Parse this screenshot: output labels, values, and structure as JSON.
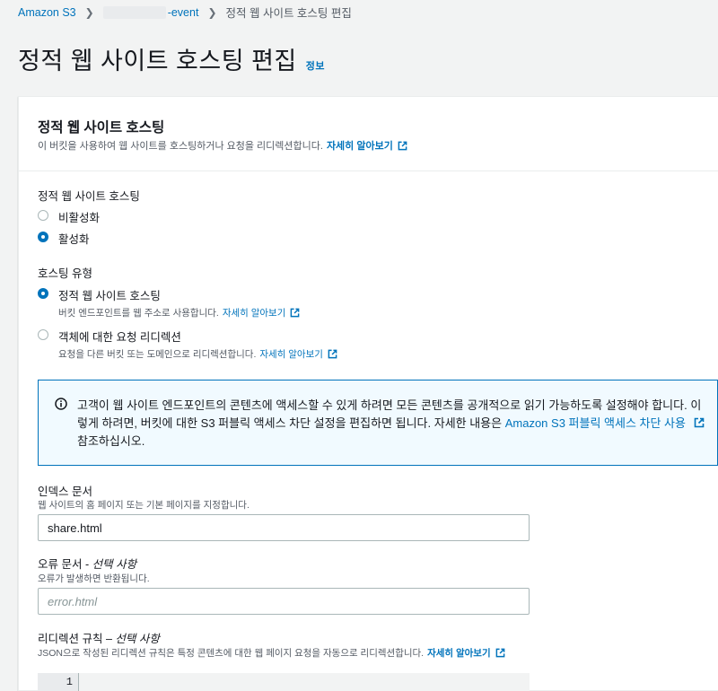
{
  "breadcrumb": {
    "root": "Amazon S3",
    "bucket": "-event",
    "current": "정적 웹 사이트 호스팅 편집"
  },
  "page": {
    "title": "정적 웹 사이트 호스팅 편집",
    "info_link": "정보"
  },
  "panel": {
    "title": "정적 웹 사이트 호스팅",
    "description": "이 버킷을 사용하여 웹 사이트를 호스팅하거나 요청을 리디렉션합니다.",
    "learn_more": "자세히 알아보기"
  },
  "hosting": {
    "label": "정적 웹 사이트 호스팅",
    "options": [
      {
        "label": "비활성화",
        "selected": false
      },
      {
        "label": "활성화",
        "selected": true
      }
    ]
  },
  "hosting_type": {
    "label": "호스팅 유형",
    "options": [
      {
        "label": "정적 웹 사이트 호스팅",
        "description": "버킷 엔드포인트를 웹 주소로 사용합니다.",
        "link": "자세히 알아보기",
        "selected": true
      },
      {
        "label": "객체에 대한 요청 리디렉션",
        "description": "요청을 다른 버킷 또는 도메인으로 리디렉션합니다.",
        "link": "자세히 알아보기",
        "selected": false
      }
    ]
  },
  "alert": {
    "text_before": "고객이 웹 사이트 엔드포인트의 콘텐츠에 액세스할 수 있게 하려면 모든 콘텐츠를 공개적으로 읽기 가능하도록 설정해야 합니다. 이렇게 하려면, 버킷에 대한 S3 퍼블릭 액세스 차단 설정을 편집하면 됩니다. 자세한 내용은 ",
    "link": "Amazon S3 퍼블릭 액세스 차단 사용",
    "text_after": " 참조하십시오."
  },
  "index_document": {
    "label": "인덱스 문서",
    "description": "웹 사이트의 홈 페이지 또는 기본 페이지를 지정합니다.",
    "value": "share.html"
  },
  "error_document": {
    "label": "오류 문서 - ",
    "optional": "선택 사항",
    "description": "오류가 발생하면 반환됩니다.",
    "placeholder": "error.html"
  },
  "redirection_rules": {
    "label": "리디렉션 규칙 – ",
    "optional": "선택 사항",
    "description": "JSON으로 작성된 리디렉션 규칙은 특정 콘텐츠에 대한 웹 페이지 요청을 자동으로 리디렉션합니다.",
    "link": "자세히 알아보기",
    "line_number": "1"
  },
  "colors": {
    "accent": "#0073bb",
    "alert_bg": "#f1faff",
    "page_bg": "#f2f3f3"
  }
}
